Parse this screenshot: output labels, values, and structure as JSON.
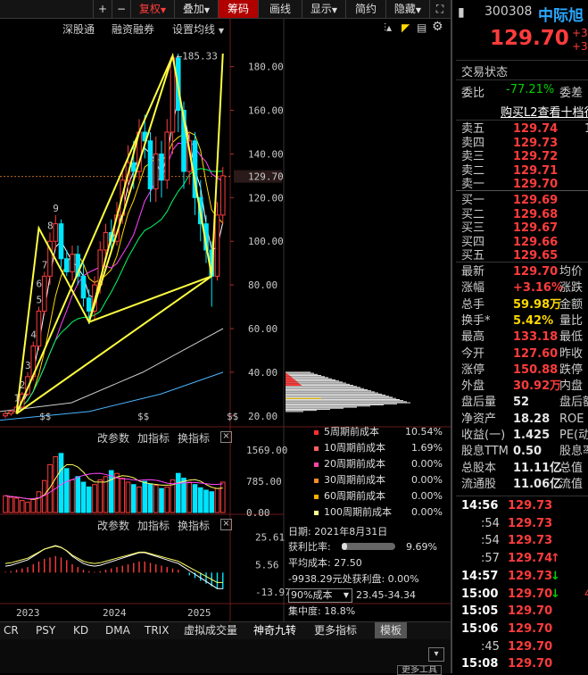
{
  "toolbar": {
    "plus": "+",
    "minus": "−",
    "items": [
      "复权",
      "叠加",
      "筹码",
      "画线",
      "显示",
      "简约",
      "隐藏"
    ],
    "fullscreen": "⛶"
  },
  "subbar": {
    "items": [
      "深股通",
      "融资融券",
      "设置均线"
    ]
  },
  "chart_data": [
    {
      "type": "candlestick",
      "yticks": [
        20,
        40,
        60,
        80,
        100,
        120,
        140,
        160,
        180
      ],
      "ylim": [
        15,
        195
      ],
      "current_price_label": "129.70",
      "high_label": "185.33",
      "xlabels": [
        "2023",
        "2024",
        "2025"
      ],
      "wave_labels": [
        "1",
        "2",
        "3",
        "4",
        "5",
        "6",
        "7",
        "8",
        "9"
      ],
      "candles": [
        [
          20,
          21,
          19,
          22
        ],
        [
          21,
          22,
          20,
          23
        ],
        [
          22,
          24,
          21,
          25
        ],
        [
          24,
          30,
          23,
          31
        ],
        [
          30,
          38,
          29,
          40
        ],
        [
          38,
          52,
          36,
          54
        ],
        [
          52,
          68,
          50,
          70
        ],
        [
          68,
          84,
          66,
          86
        ],
        [
          84,
          100,
          80,
          104
        ],
        [
          100,
          108,
          96,
          112
        ],
        [
          108,
          92,
          88,
          110
        ],
        [
          92,
          86,
          84,
          96
        ],
        [
          86,
          94,
          82,
          98
        ],
        [
          94,
          84,
          80,
          98
        ],
        [
          84,
          74,
          70,
          90
        ],
        [
          74,
          68,
          62,
          78
        ],
        [
          68,
          80,
          64,
          84
        ],
        [
          80,
          96,
          76,
          100
        ],
        [
          96,
          104,
          92,
          108
        ],
        [
          104,
          100,
          96,
          110
        ],
        [
          100,
          112,
          98,
          118
        ],
        [
          112,
          128,
          108,
          132
        ],
        [
          128,
          136,
          122,
          144
        ],
        [
          136,
          132,
          124,
          146
        ],
        [
          132,
          150,
          128,
          156
        ],
        [
          150,
          146,
          138,
          158
        ],
        [
          146,
          124,
          118,
          150
        ],
        [
          124,
          140,
          118,
          148
        ],
        [
          140,
          128,
          120,
          146
        ],
        [
          128,
          150,
          124,
          156
        ],
        [
          150,
          184,
          140,
          186
        ],
        [
          184,
          160,
          150,
          186
        ],
        [
          160,
          132,
          124,
          164
        ],
        [
          132,
          146,
          126,
          150
        ],
        [
          146,
          120,
          112,
          150
        ],
        [
          120,
          108,
          100,
          128
        ],
        [
          108,
          96,
          90,
          112
        ],
        [
          96,
          84,
          70,
          100
        ],
        [
          84,
          112,
          82,
          118
        ],
        [
          112,
          130,
          108,
          134
        ]
      ],
      "chip_distribution": "present"
    },
    {
      "type": "bar",
      "name": "volume",
      "yticks": [
        "1569.00",
        "785.00",
        "0.00"
      ],
      "ylim": [
        0,
        1700
      ],
      "values": [
        420,
        380,
        360,
        300,
        260,
        340,
        520,
        800,
        1200,
        1400,
        1480,
        1100,
        820,
        900,
        760,
        640,
        700,
        820,
        900,
        1050,
        980,
        860,
        760,
        700,
        640,
        780,
        720,
        680,
        600,
        640,
        820,
        980,
        860,
        760,
        700,
        620,
        560,
        520,
        600,
        760
      ]
    },
    {
      "type": "bar",
      "name": "macd",
      "yticks": [
        "25.61",
        "5.56",
        "-13.97"
      ],
      "ylim": [
        -16,
        28
      ],
      "values": [
        0.5,
        1,
        2,
        3,
        4,
        6,
        8,
        10,
        11,
        12,
        11,
        9,
        6,
        4,
        2,
        1,
        0.5,
        1,
        2,
        3,
        4,
        5,
        6,
        7,
        8,
        8,
        7,
        6,
        5,
        4,
        3,
        2,
        0,
        -2,
        -4,
        -6,
        -8,
        -10,
        -12,
        -12
      ]
    }
  ],
  "panels": {
    "volume": {
      "buttons": [
        "改参数",
        "加指标",
        "换指标"
      ],
      "close": "×"
    },
    "indicator": {
      "buttons": [
        "改参数",
        "加指标",
        "换指标"
      ],
      "close": "×"
    }
  },
  "legend": [
    {
      "label": "5周期前成本",
      "value": "10.54%",
      "color": "#ff3030"
    },
    {
      "label": "10周期前成本",
      "value": "1.69%",
      "color": "#ff6060"
    },
    {
      "label": "20周期前成本",
      "value": "0.00%",
      "color": "#ff44aa"
    },
    {
      "label": "30周期前成本",
      "value": "0.00%",
      "color": "#ff8c2a"
    },
    {
      "label": "60周期前成本",
      "value": "0.00%",
      "color": "#ffb000"
    },
    {
      "label": "100周期前成本",
      "value": "0.00%",
      "color": "#ffff90"
    }
  ],
  "chip_info": {
    "date": "日期: 2021年8月31日",
    "profit_label": "获利比率:",
    "profit_value": "9.69%",
    "avg_cost": "平均成本: 27.50",
    "profit_line": "-9938.29元处获利盘: 0.00%",
    "cost_select": "90%成本",
    "cost_range": "23.45-34.34",
    "concentration": "集中度: 18.8%"
  },
  "bottom_tabs": [
    "CR",
    "PSY",
    "KD",
    "DMA",
    "TRIX",
    "虚拟成交量",
    "神奇九转",
    "更多指标",
    "模板"
  ],
  "bottom_right": "更多工具",
  "quote": {
    "code": "300308",
    "name": "中际旭",
    "price": "129.70",
    "change1": "+3.",
    "change2": "+3.",
    "section_title": "交易状态",
    "weibi_label": "委比",
    "weibi_value": "-77.21%",
    "weicha_label": "委差",
    "l2_link": "购买L2查看十档行",
    "asks": [
      {
        "label": "卖五",
        "price": "129.74",
        "vol": "1"
      },
      {
        "label": "卖四",
        "price": "129.73",
        "vol": ""
      },
      {
        "label": "卖三",
        "price": "129.72",
        "vol": ""
      },
      {
        "label": "卖二",
        "price": "129.71",
        "vol": ""
      },
      {
        "label": "卖一",
        "price": "129.70",
        "vol": ""
      }
    ],
    "bids": [
      {
        "label": "买一",
        "price": "129.69"
      },
      {
        "label": "买二",
        "price": "129.68"
      },
      {
        "label": "买三",
        "price": "129.67"
      },
      {
        "label": "买四",
        "price": "129.66"
      },
      {
        "label": "买五",
        "price": "129.65"
      }
    ],
    "stats": [
      {
        "l": "最新",
        "v": "129.70",
        "c": "#ff3c3c",
        "r": "均价"
      },
      {
        "l": "涨幅",
        "v": "+3.16%",
        "c": "#ff3c3c",
        "r": "涨跌"
      },
      {
        "l": "总手",
        "v": "59.98万",
        "c": "#ffd800",
        "r": "金额"
      },
      {
        "l": "换手*",
        "v": "5.42%",
        "c": "#ffd800",
        "r": "量比"
      },
      {
        "l": "最高",
        "v": "133.18",
        "c": "#ff3c3c",
        "r": "最低"
      },
      {
        "l": "今开",
        "v": "127.60",
        "c": "#ff3c3c",
        "r": "昨收"
      },
      {
        "l": "涨停",
        "v": "150.88",
        "c": "#ff3c3c",
        "r": "跌停"
      },
      {
        "l": "外盘",
        "v": "30.92万",
        "c": "#ff3c3c",
        "r": "内盘"
      },
      {
        "l": "盘后量",
        "v": "52",
        "c": "#e6e6e6",
        "r": "盘后额"
      },
      {
        "l": "净资产",
        "v": "18.28",
        "c": "#e6e6e6",
        "r": "ROE"
      },
      {
        "l": "收益(一)",
        "v": "1.425",
        "c": "#e6e6e6",
        "r": "PE(动"
      },
      {
        "l": "股息TTM",
        "v": "0.50",
        "c": "#e6e6e6",
        "r": "股息率"
      },
      {
        "l": "总股本",
        "v": "11.11亿",
        "c": "#e6e6e6",
        "r": "总值"
      },
      {
        "l": "流通股",
        "v": "11.06亿",
        "c": "#e6e6e6",
        "r": "流值"
      }
    ],
    "ticks": [
      {
        "t": "14:56",
        "p": "129.73",
        "a": ""
      },
      {
        "t": ":54",
        "p": "129.73",
        "a": ""
      },
      {
        "t": ":54",
        "p": "129.73",
        "a": ""
      },
      {
        "t": ":57",
        "p": "129.74",
        "a": "↑"
      },
      {
        "t": "14:57",
        "p": "129.73",
        "a": "↓"
      },
      {
        "t": "15:00",
        "p": "129.70",
        "a": "↓",
        "extra": "4"
      },
      {
        "t": "15:05",
        "p": "129.70",
        "a": ""
      },
      {
        "t": "15:06",
        "p": "129.70",
        "a": ""
      },
      {
        "t": ":45",
        "p": "129.70",
        "a": ""
      },
      {
        "t": "15:08",
        "p": "129.70",
        "a": ""
      }
    ]
  }
}
